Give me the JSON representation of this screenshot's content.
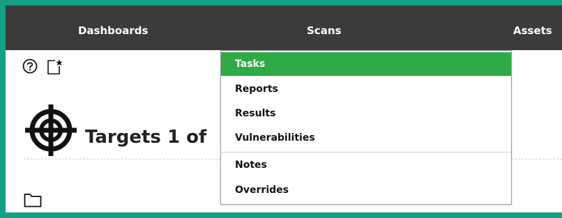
{
  "nav": {
    "items": [
      {
        "label": "Dashboards"
      },
      {
        "label": "Scans"
      },
      {
        "label": "Assets"
      }
    ]
  },
  "toolbar": {
    "icons": [
      "help-icon",
      "new-icon"
    ]
  },
  "page": {
    "title": "Targets 1 of",
    "title_icon": "target-icon",
    "list_icon": "folder-icon"
  },
  "dropdown": {
    "items": [
      {
        "label": "Tasks",
        "active": true
      },
      {
        "label": "Reports"
      },
      {
        "label": "Results"
      },
      {
        "label": "Vulnerabilities"
      },
      {
        "label": "Notes"
      },
      {
        "label": "Overrides"
      }
    ]
  },
  "colors": {
    "border": "#13a083",
    "nav_bg": "#3b3b3b",
    "active_bg": "#2eab47"
  }
}
